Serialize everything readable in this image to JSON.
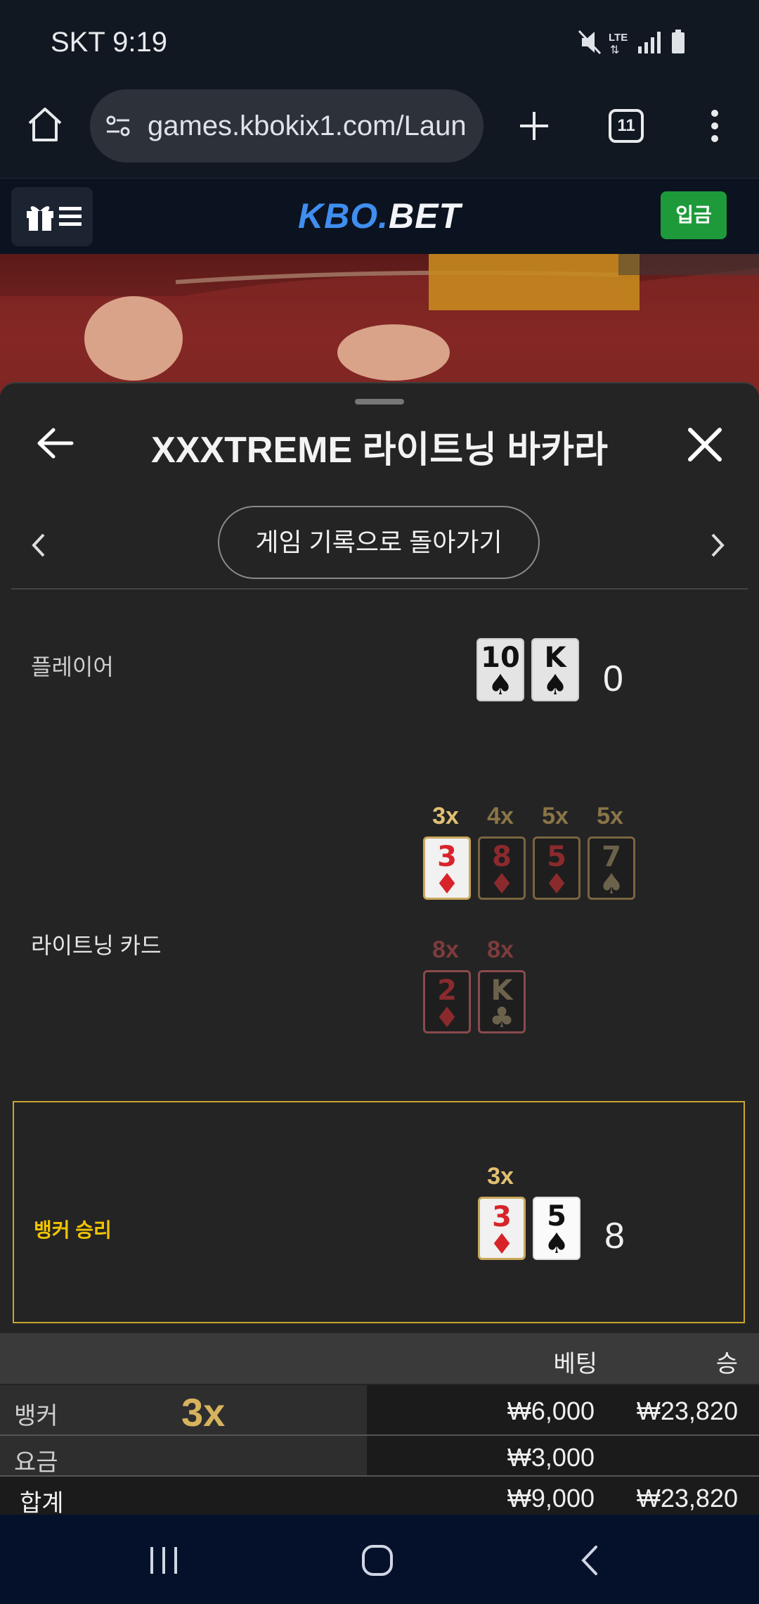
{
  "status": {
    "time": "SKT 9:19"
  },
  "browser": {
    "url": "games.kbokix1.com/Laun",
    "tab_count": "11"
  },
  "appbar": {
    "logo_main": "KBO",
    "logo_dot": ".",
    "logo_suffix": "BET",
    "deposit_label": "입금"
  },
  "panel": {
    "title": "XXXTREME 라이트닝 바카라",
    "history_button": "게임 기록으로 돌아가기",
    "player": {
      "label": "플레이어",
      "score": "0",
      "cards": [
        {
          "rank": "10",
          "suit": "♠"
        },
        {
          "rank": "K",
          "suit": "♠"
        }
      ]
    },
    "lightning": {
      "label": "라이트닝 카드",
      "row1": [
        {
          "mult": "3x",
          "rank": "3",
          "suit": "♦"
        },
        {
          "mult": "4x",
          "rank": "8",
          "suit": "♦"
        },
        {
          "mult": "5x",
          "rank": "5",
          "suit": "♦"
        },
        {
          "mult": "5x",
          "rank": "7",
          "suit": "♠"
        }
      ],
      "row2": [
        {
          "mult": "8x",
          "rank": "2",
          "suit": "♦"
        },
        {
          "mult": "8x",
          "rank": "K",
          "suit": "♣"
        }
      ]
    },
    "banker": {
      "label": "뱅커 승리",
      "score": "8",
      "mult": "3x",
      "cards": [
        {
          "rank": "3",
          "suit": "♦"
        },
        {
          "rank": "5",
          "suit": "♠"
        }
      ]
    },
    "table": {
      "headers": {
        "bet": "베팅",
        "win": "승"
      },
      "rows": [
        {
          "label": "뱅커",
          "mult": "3x",
          "bet": "₩6,000",
          "win": "₩23,820"
        },
        {
          "label": "요금",
          "bet": "₩3,000",
          "win": ""
        },
        {
          "label": "합계",
          "bet": "₩9,000",
          "win": "₩23,820"
        }
      ]
    }
  },
  "colors": {
    "accent_blue": "#3f8ef0",
    "deposit_green": "#1e9a3a",
    "gold": "#e2c073",
    "win_yellow": "#f1c400"
  }
}
